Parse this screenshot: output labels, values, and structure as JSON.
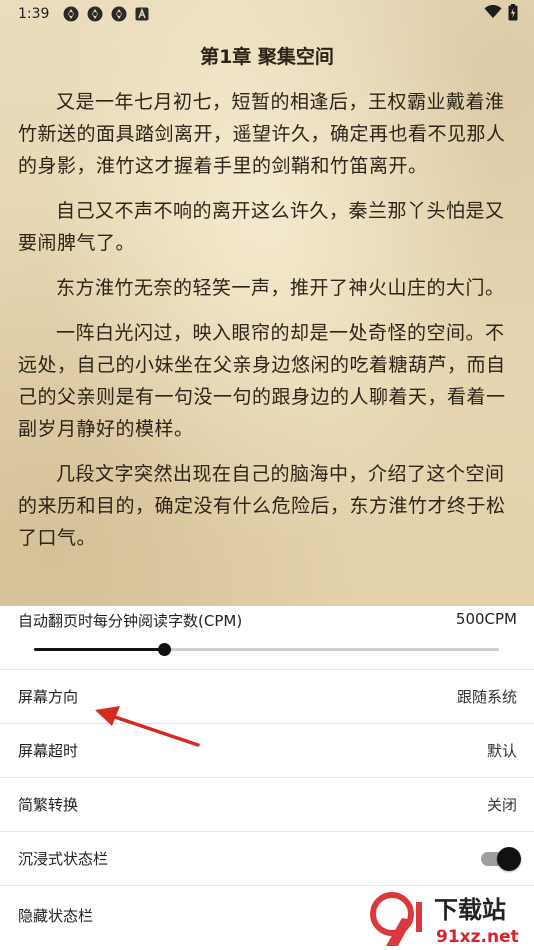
{
  "status_bar": {
    "time": "1:39",
    "notification_icons": [
      "pinwheel-icon",
      "pinwheel-icon",
      "pinwheel-icon",
      "font-a-icon"
    ],
    "right_icons": [
      "wifi-icon",
      "battery-icon"
    ]
  },
  "reader": {
    "chapter_title": "第1章 聚集空间",
    "paragraphs": [
      "又是一年七月初七，短暂的相逢后，王权霸业戴着淮竹新送的面具踏剑离开，遥望许久，确定再也看不见那人的身影，淮竹这才握着手里的剑鞘和竹笛离开。",
      "自己又不声不响的离开这么许久，秦兰那丫头怕是又要闹脾气了。",
      "东方淮竹无奈的轻笑一声，推开了神火山庄的大门。",
      "一阵白光闪过，映入眼帘的却是一处奇怪的空间。不远处，自己的小妹坐在父亲身边悠闲的吃着糖葫芦，而自己的父亲则是有一句没一句的跟身边的人聊着天，看着一副岁月静好的模样。",
      "几段文字突然出现在自己的脑海中，介绍了这个空间的来历和目的，确定没有什么危险后，东方淮竹才终于松了口气。"
    ]
  },
  "settings": {
    "cpm": {
      "label": "自动翻页时每分钟阅读字数(CPM)",
      "value": "500CPM",
      "slider_fraction": 0.28
    },
    "rows": [
      {
        "label": "屏幕方向",
        "value": "跟随系统"
      },
      {
        "label": "屏幕超时",
        "value": "默认"
      },
      {
        "label": "简繁转换",
        "value": "关闭"
      },
      {
        "label": "沉浸式状态栏",
        "toggle_on": true
      },
      {
        "label": "隐藏状态栏"
      }
    ]
  },
  "annotation": {
    "arrow_color": "#d42a22",
    "target": "屏幕方向"
  },
  "watermark": {
    "text_top": "下载站",
    "text_bottom": "91xz.net",
    "colors": {
      "red": "#d8232a",
      "dark": "#222222"
    }
  }
}
